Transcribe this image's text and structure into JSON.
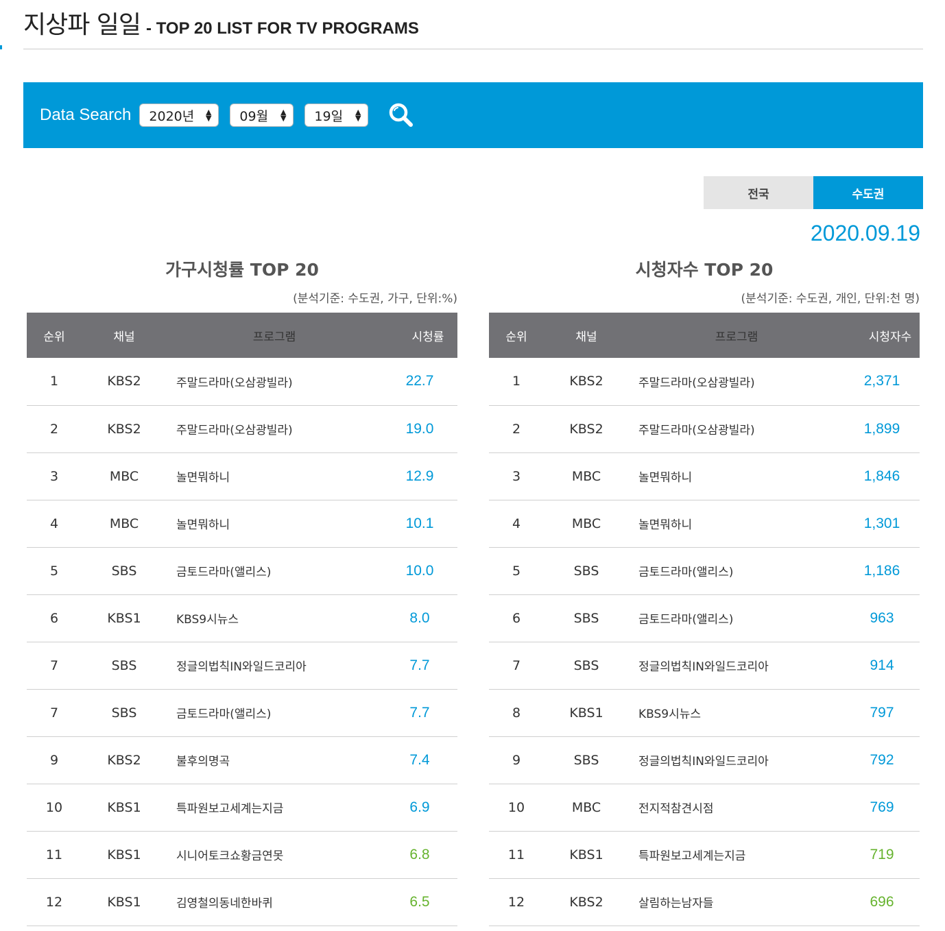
{
  "header": {
    "title_ko": "지상파 일일",
    "title_en": "- TOP 20 LIST FOR TV PROGRAMS"
  },
  "search": {
    "label": "Data Search",
    "year": "2020년",
    "month": "09월",
    "day": "19일",
    "icon": "search-icon"
  },
  "region_tabs": [
    {
      "label": "전국",
      "active": false
    },
    {
      "label": "수도권",
      "active": true
    }
  ],
  "date": "2020.09.19",
  "colors": {
    "accent": "#0099d8",
    "green": "#66b32e",
    "header_gray": "#717175"
  },
  "household": {
    "title": "가구시청률 TOP 20",
    "note": "(분석기준: 수도권, 가구, 단위:%)",
    "columns": [
      "순위",
      "채널",
      "프로그램",
      "시청률"
    ],
    "rows": [
      {
        "rank": "1",
        "channel": "KBS2",
        "program": "주말드라마(오삼광빌라)",
        "value": "22.7",
        "color": "blue"
      },
      {
        "rank": "2",
        "channel": "KBS2",
        "program": "주말드라마(오삼광빌라)",
        "value": "19.0",
        "color": "blue"
      },
      {
        "rank": "3",
        "channel": "MBC",
        "program": "놀면뭐하니",
        "value": "12.9",
        "color": "blue"
      },
      {
        "rank": "4",
        "channel": "MBC",
        "program": "놀면뭐하니",
        "value": "10.1",
        "color": "blue"
      },
      {
        "rank": "5",
        "channel": "SBS",
        "program": "금토드라마(앨리스)",
        "value": "10.0",
        "color": "blue"
      },
      {
        "rank": "6",
        "channel": "KBS1",
        "program": "KBS9시뉴스",
        "value": "8.0",
        "color": "blue"
      },
      {
        "rank": "7",
        "channel": "SBS",
        "program": "정글의법칙IN와일드코리아",
        "value": "7.7",
        "color": "blue"
      },
      {
        "rank": "7",
        "channel": "SBS",
        "program": "금토드라마(앨리스)",
        "value": "7.7",
        "color": "blue"
      },
      {
        "rank": "9",
        "channel": "KBS2",
        "program": "불후의명곡",
        "value": "7.4",
        "color": "blue"
      },
      {
        "rank": "10",
        "channel": "KBS1",
        "program": "특파원보고세계는지금",
        "value": "6.9",
        "color": "blue"
      },
      {
        "rank": "11",
        "channel": "KBS1",
        "program": "시니어토크쇼황금연못",
        "value": "6.8",
        "color": "green"
      },
      {
        "rank": "12",
        "channel": "KBS1",
        "program": "김영철의동네한바퀴",
        "value": "6.5",
        "color": "green"
      }
    ]
  },
  "viewers": {
    "title": "시청자수 TOP 20",
    "note": "(분석기준: 수도권, 개인, 단위:천 명)",
    "columns": [
      "순위",
      "채널",
      "프로그램",
      "시청자수"
    ],
    "rows": [
      {
        "rank": "1",
        "channel": "KBS2",
        "program": "주말드라마(오삼광빌라)",
        "value": "2,371",
        "color": "blue"
      },
      {
        "rank": "2",
        "channel": "KBS2",
        "program": "주말드라마(오삼광빌라)",
        "value": "1,899",
        "color": "blue"
      },
      {
        "rank": "3",
        "channel": "MBC",
        "program": "놀면뭐하니",
        "value": "1,846",
        "color": "blue"
      },
      {
        "rank": "4",
        "channel": "MBC",
        "program": "놀면뭐하니",
        "value": "1,301",
        "color": "blue"
      },
      {
        "rank": "5",
        "channel": "SBS",
        "program": "금토드라마(앨리스)",
        "value": "1,186",
        "color": "blue"
      },
      {
        "rank": "6",
        "channel": "SBS",
        "program": "금토드라마(앨리스)",
        "value": "963",
        "color": "blue"
      },
      {
        "rank": "7",
        "channel": "SBS",
        "program": "정글의법칙IN와일드코리아",
        "value": "914",
        "color": "blue"
      },
      {
        "rank": "8",
        "channel": "KBS1",
        "program": "KBS9시뉴스",
        "value": "797",
        "color": "blue"
      },
      {
        "rank": "9",
        "channel": "SBS",
        "program": "정글의법칙IN와일드코리아",
        "value": "792",
        "color": "blue"
      },
      {
        "rank": "10",
        "channel": "MBC",
        "program": "전지적참견시점",
        "value": "769",
        "color": "blue"
      },
      {
        "rank": "11",
        "channel": "KBS1",
        "program": "특파원보고세계는지금",
        "value": "719",
        "color": "green"
      },
      {
        "rank": "12",
        "channel": "KBS2",
        "program": "살림하는남자들",
        "value": "696",
        "color": "green"
      }
    ]
  }
}
